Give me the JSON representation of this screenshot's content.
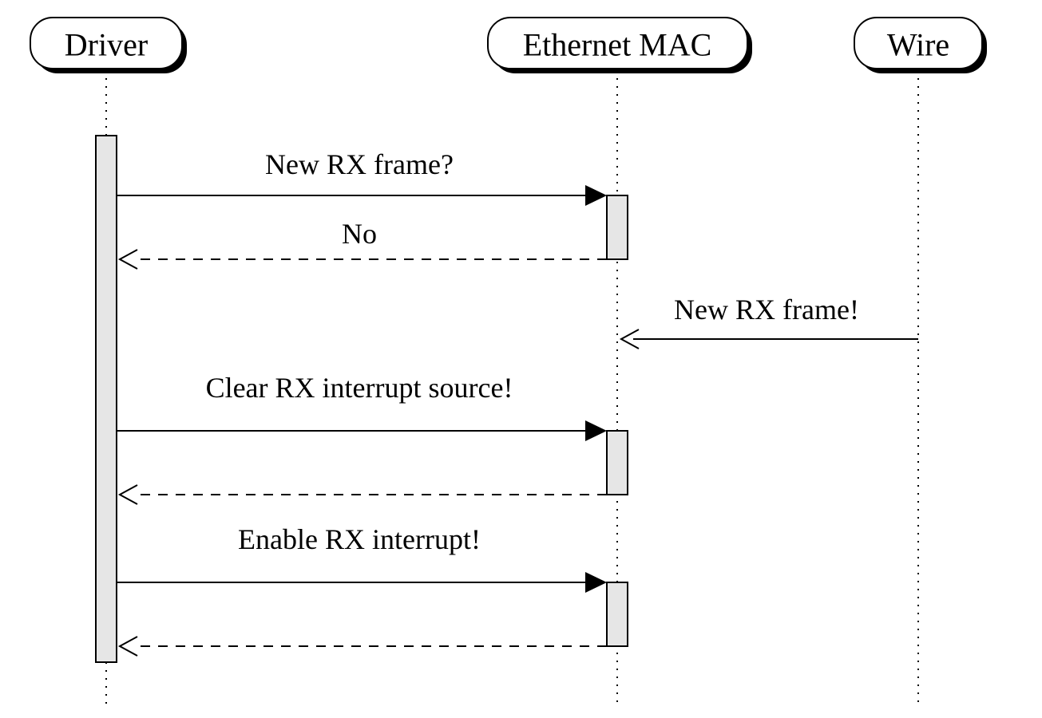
{
  "participants": {
    "driver": {
      "label": "Driver"
    },
    "mac": {
      "label": "Ethernet MAC"
    },
    "wire": {
      "label": "Wire"
    }
  },
  "messages": {
    "m1": {
      "label": "New RX frame?"
    },
    "m2": {
      "label": "No"
    },
    "m3": {
      "label": "New RX frame!"
    },
    "m4": {
      "label": "Clear RX interrupt source!"
    },
    "m5": {
      "label": "Enable RX interrupt!"
    }
  }
}
